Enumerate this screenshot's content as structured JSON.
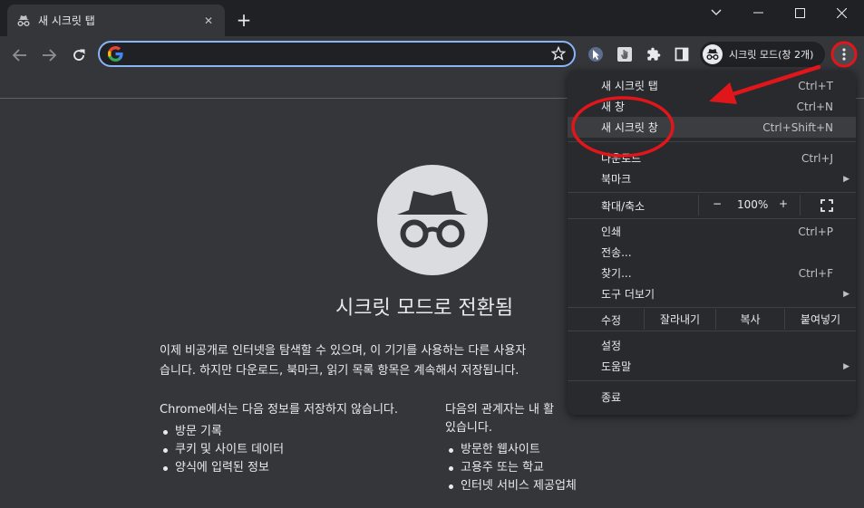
{
  "tab": {
    "title": "새 시크릿 탭",
    "close": "✕"
  },
  "newtab": "+",
  "omnibox": {
    "value": "",
    "placeholder": ""
  },
  "profile": {
    "label": "시크릿 모드(창 2개)"
  },
  "ntp": {
    "title": "시크릿 모드로 전환됨",
    "desc_line1": "이제 비공개로 인터넷을 탐색할 수 있으며, 이 기기를 사용하는 다른 사용자",
    "desc_line2": "습니다. 하지만 다운로드, 북마크, 읽기 목록 항목은 계속해서 저장됩니다.",
    "col1": {
      "heading": "Chrome에서는 다음 정보를 저장하지 않습니다.",
      "items": [
        "방문 기록",
        "쿠키 및 사이트 데이터",
        "양식에 입력된 정보"
      ]
    },
    "col2": {
      "heading_line1": "다음의 관계자는 내 활",
      "heading_line2": "있습니다.",
      "items": [
        "방문한 웹사이트",
        "고용주 또는 학교",
        "인터넷 서비스 제공업체"
      ]
    }
  },
  "menu": {
    "new_tab": {
      "label": "새 시크릿 탭",
      "shortcut": "Ctrl+T"
    },
    "new_window": {
      "label": "새 창",
      "shortcut": "Ctrl+N"
    },
    "new_incognito": {
      "label": "새 시크릿 창",
      "shortcut": "Ctrl+Shift+N"
    },
    "downloads": {
      "label": "다운로드",
      "shortcut": "Ctrl+J"
    },
    "bookmarks": {
      "label": "북마크",
      "arrow": "▶"
    },
    "zoom": {
      "label": "확대/축소",
      "minus": "−",
      "value": "100%",
      "plus": "+"
    },
    "print": {
      "label": "인쇄",
      "shortcut": "Ctrl+P"
    },
    "cast": {
      "label": "전송..."
    },
    "find": {
      "label": "찾기...",
      "shortcut": "Ctrl+F"
    },
    "more_tools": {
      "label": "도구 더보기",
      "arrow": "▶"
    },
    "edit": {
      "label": "수정",
      "cut": "잘라내기",
      "copy": "복사",
      "paste": "붙여넣기"
    },
    "settings": {
      "label": "설정"
    },
    "help": {
      "label": "도움말",
      "arrow": "▶"
    },
    "exit": {
      "label": "종료"
    }
  },
  "colors": {
    "annotation": "#e0161b",
    "focus": "#8ab4f8",
    "menu_bg": "#292a2d",
    "page_bg": "#35363a"
  }
}
